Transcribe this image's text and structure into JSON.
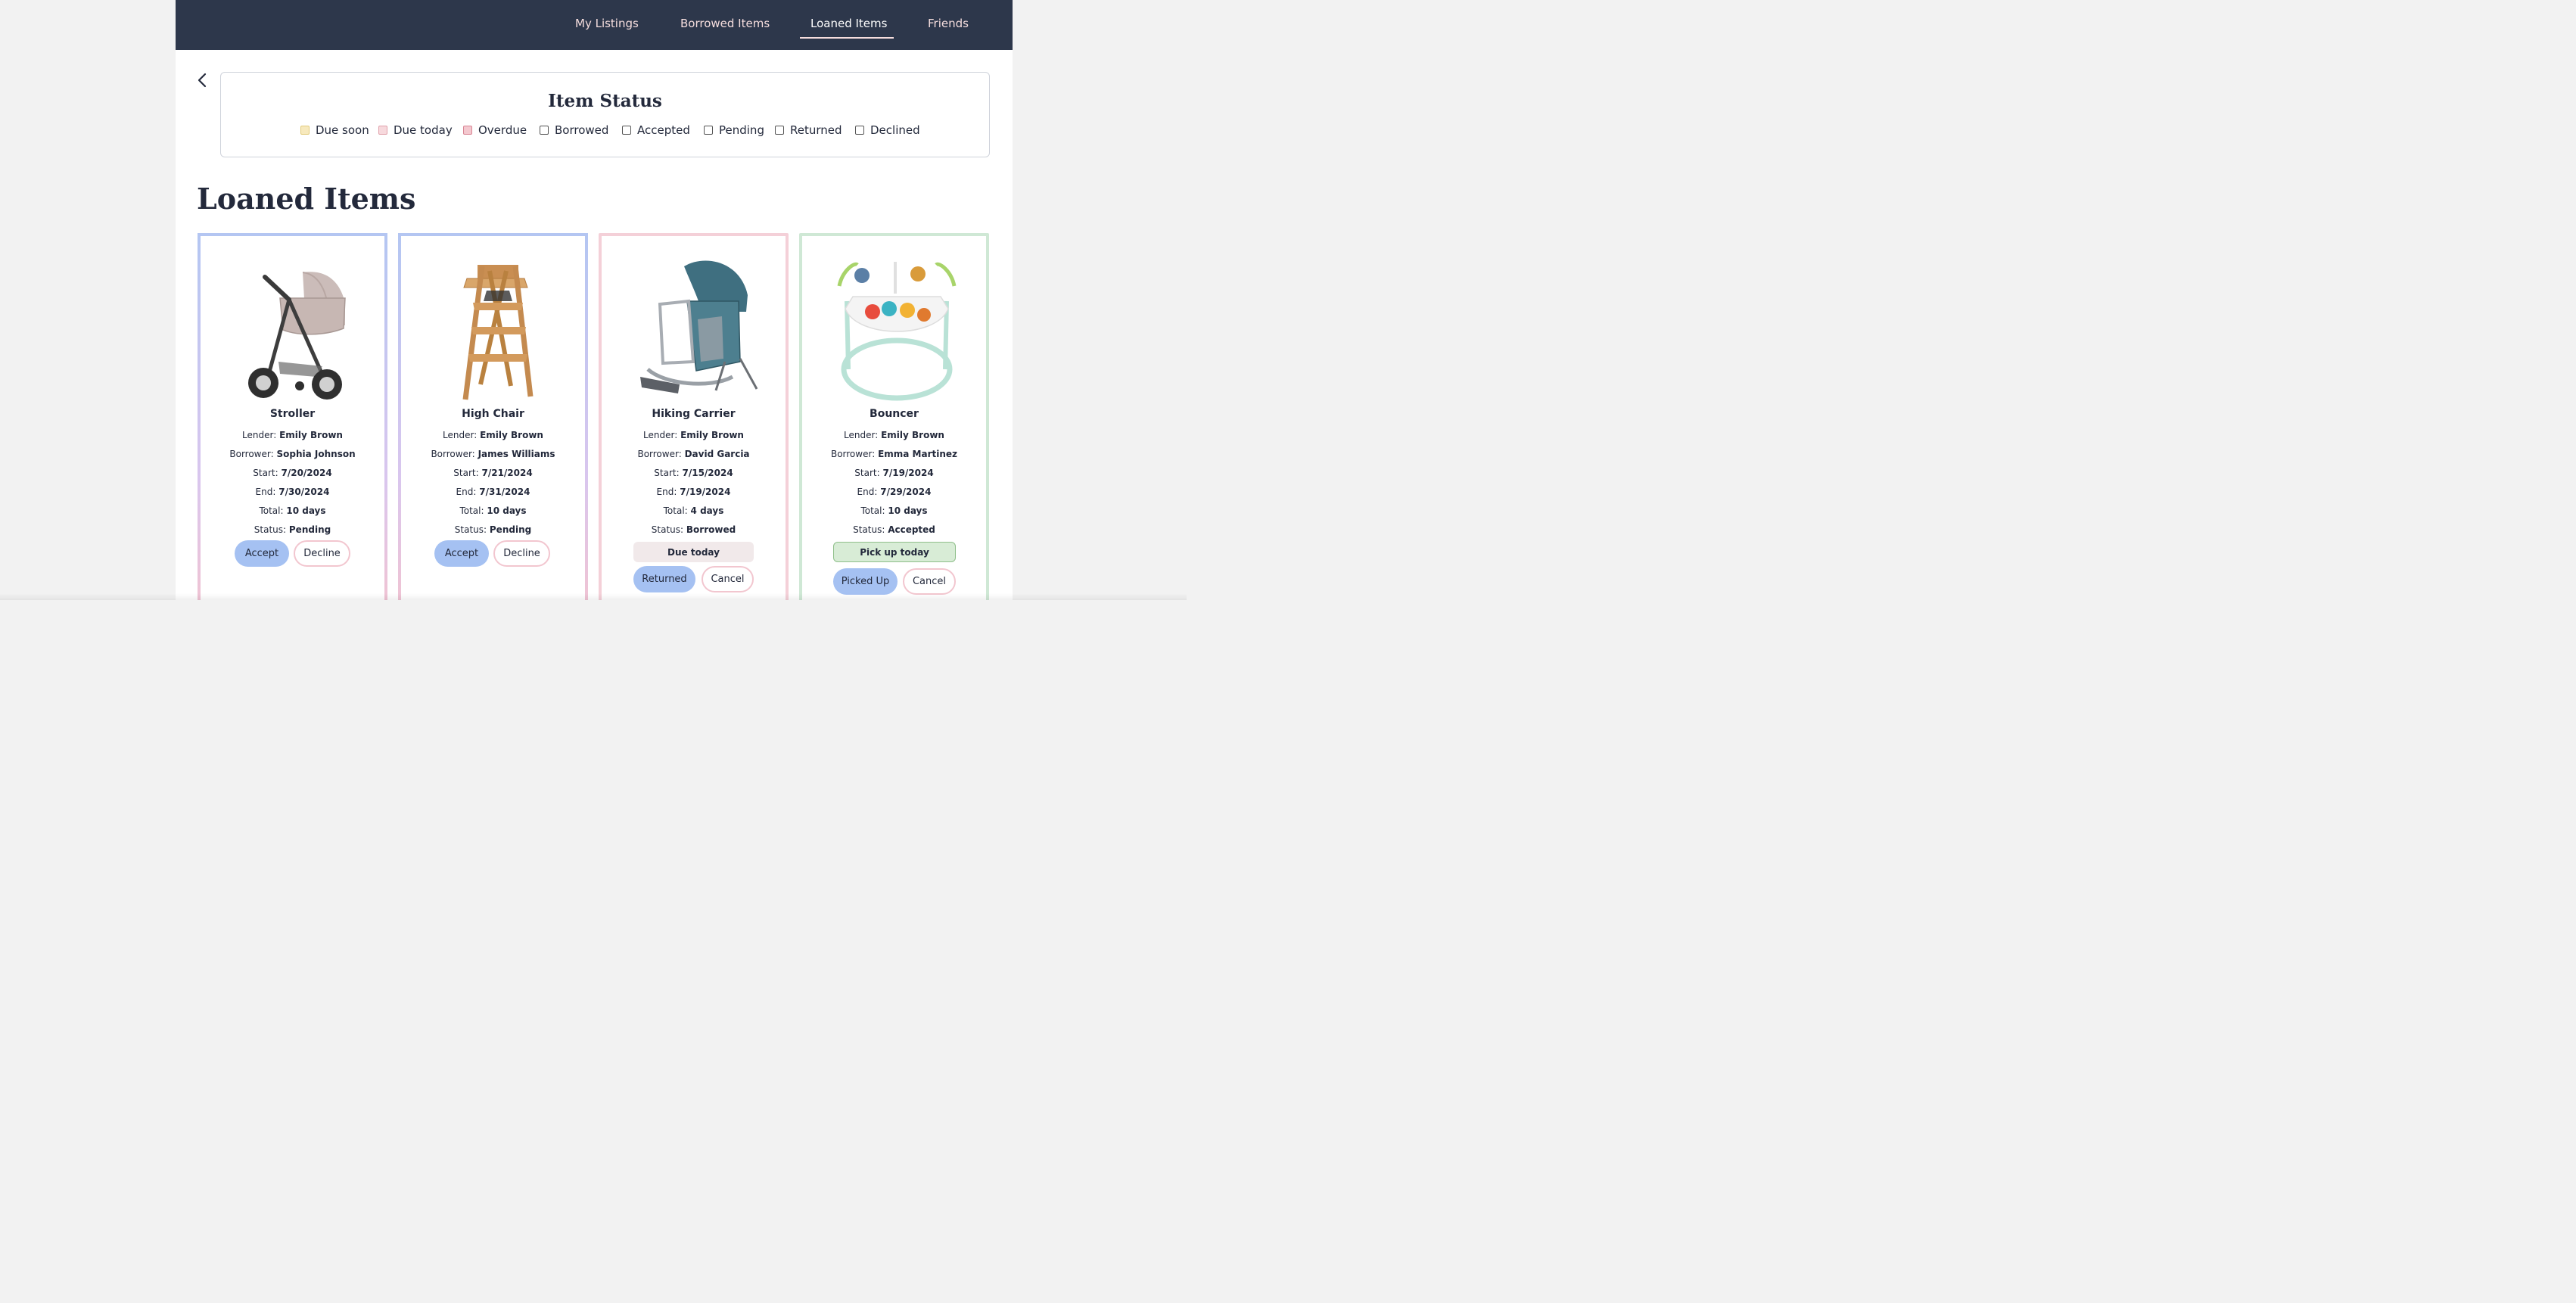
{
  "nav": {
    "items": [
      {
        "label": "My Listings"
      },
      {
        "label": "Borrowed Items"
      },
      {
        "label": "Loaned Items",
        "active": true
      },
      {
        "label": "Friends"
      }
    ]
  },
  "status_panel": {
    "title": "Item Status",
    "legend": [
      {
        "label": "Due soon",
        "color": "#f7e9bd"
      },
      {
        "label": "Due today",
        "color": "#f7d9dd"
      },
      {
        "label": "Overdue",
        "color": "#f4c8cf"
      },
      {
        "label": "Borrowed",
        "color": "#ffffff"
      },
      {
        "label": "Accepted",
        "color": "#ffffff"
      },
      {
        "label": "Pending",
        "color": "#ffffff"
      },
      {
        "label": "Returned",
        "color": "#ffffff"
      },
      {
        "label": "Declined",
        "color": "#ffffff"
      }
    ]
  },
  "page": {
    "title": "Loaned Items"
  },
  "labels": {
    "lender": "Lender:",
    "borrower": "Borrower:",
    "start": "Start:",
    "end": "End:",
    "total": "Total:",
    "status": "Status:"
  },
  "cards": [
    {
      "title": "Stroller",
      "image": "stroller",
      "lender": "Emily Brown",
      "borrower": "Sophia Johnson",
      "start": "7/20/2024",
      "end": "7/30/2024",
      "total": "10 days",
      "status": "Pending",
      "primary_button": "Accept",
      "secondary_button": "Decline"
    },
    {
      "title": "High Chair",
      "image": "high-chair",
      "lender": "Emily Brown",
      "borrower": "James Williams",
      "start": "7/21/2024",
      "end": "7/31/2024",
      "total": "10 days",
      "status": "Pending",
      "primary_button": "Accept",
      "secondary_button": "Decline"
    },
    {
      "title": "Hiking Carrier",
      "image": "hiking-carrier",
      "lender": "Emily Brown",
      "borrower": "David Garcia",
      "start": "7/15/2024",
      "end": "7/19/2024",
      "total": "4 days",
      "status": "Borrowed",
      "notice": "Due today",
      "primary_button": "Returned",
      "secondary_button": "Cancel"
    },
    {
      "title": "Bouncer",
      "image": "bouncer",
      "lender": "Emily Brown",
      "borrower": "Emma Martinez",
      "start": "7/19/2024",
      "end": "7/29/2024",
      "total": "10 days",
      "status": "Accepted",
      "notice": "Pick up today",
      "primary_button": "Picked Up",
      "secondary_button": "Cancel"
    }
  ],
  "colors": {
    "navbar": "#2d374b",
    "primary_button": "#a5c1f2",
    "pending_border": "#b4c6f2",
    "pending_border_bottom": "#f1c3d2",
    "borrowed_border": "#f4d0d8",
    "accepted_border": "#cfe8d5",
    "due_today_pill": "#f1e9ea",
    "pickup_pill": "#d8ecd6"
  }
}
